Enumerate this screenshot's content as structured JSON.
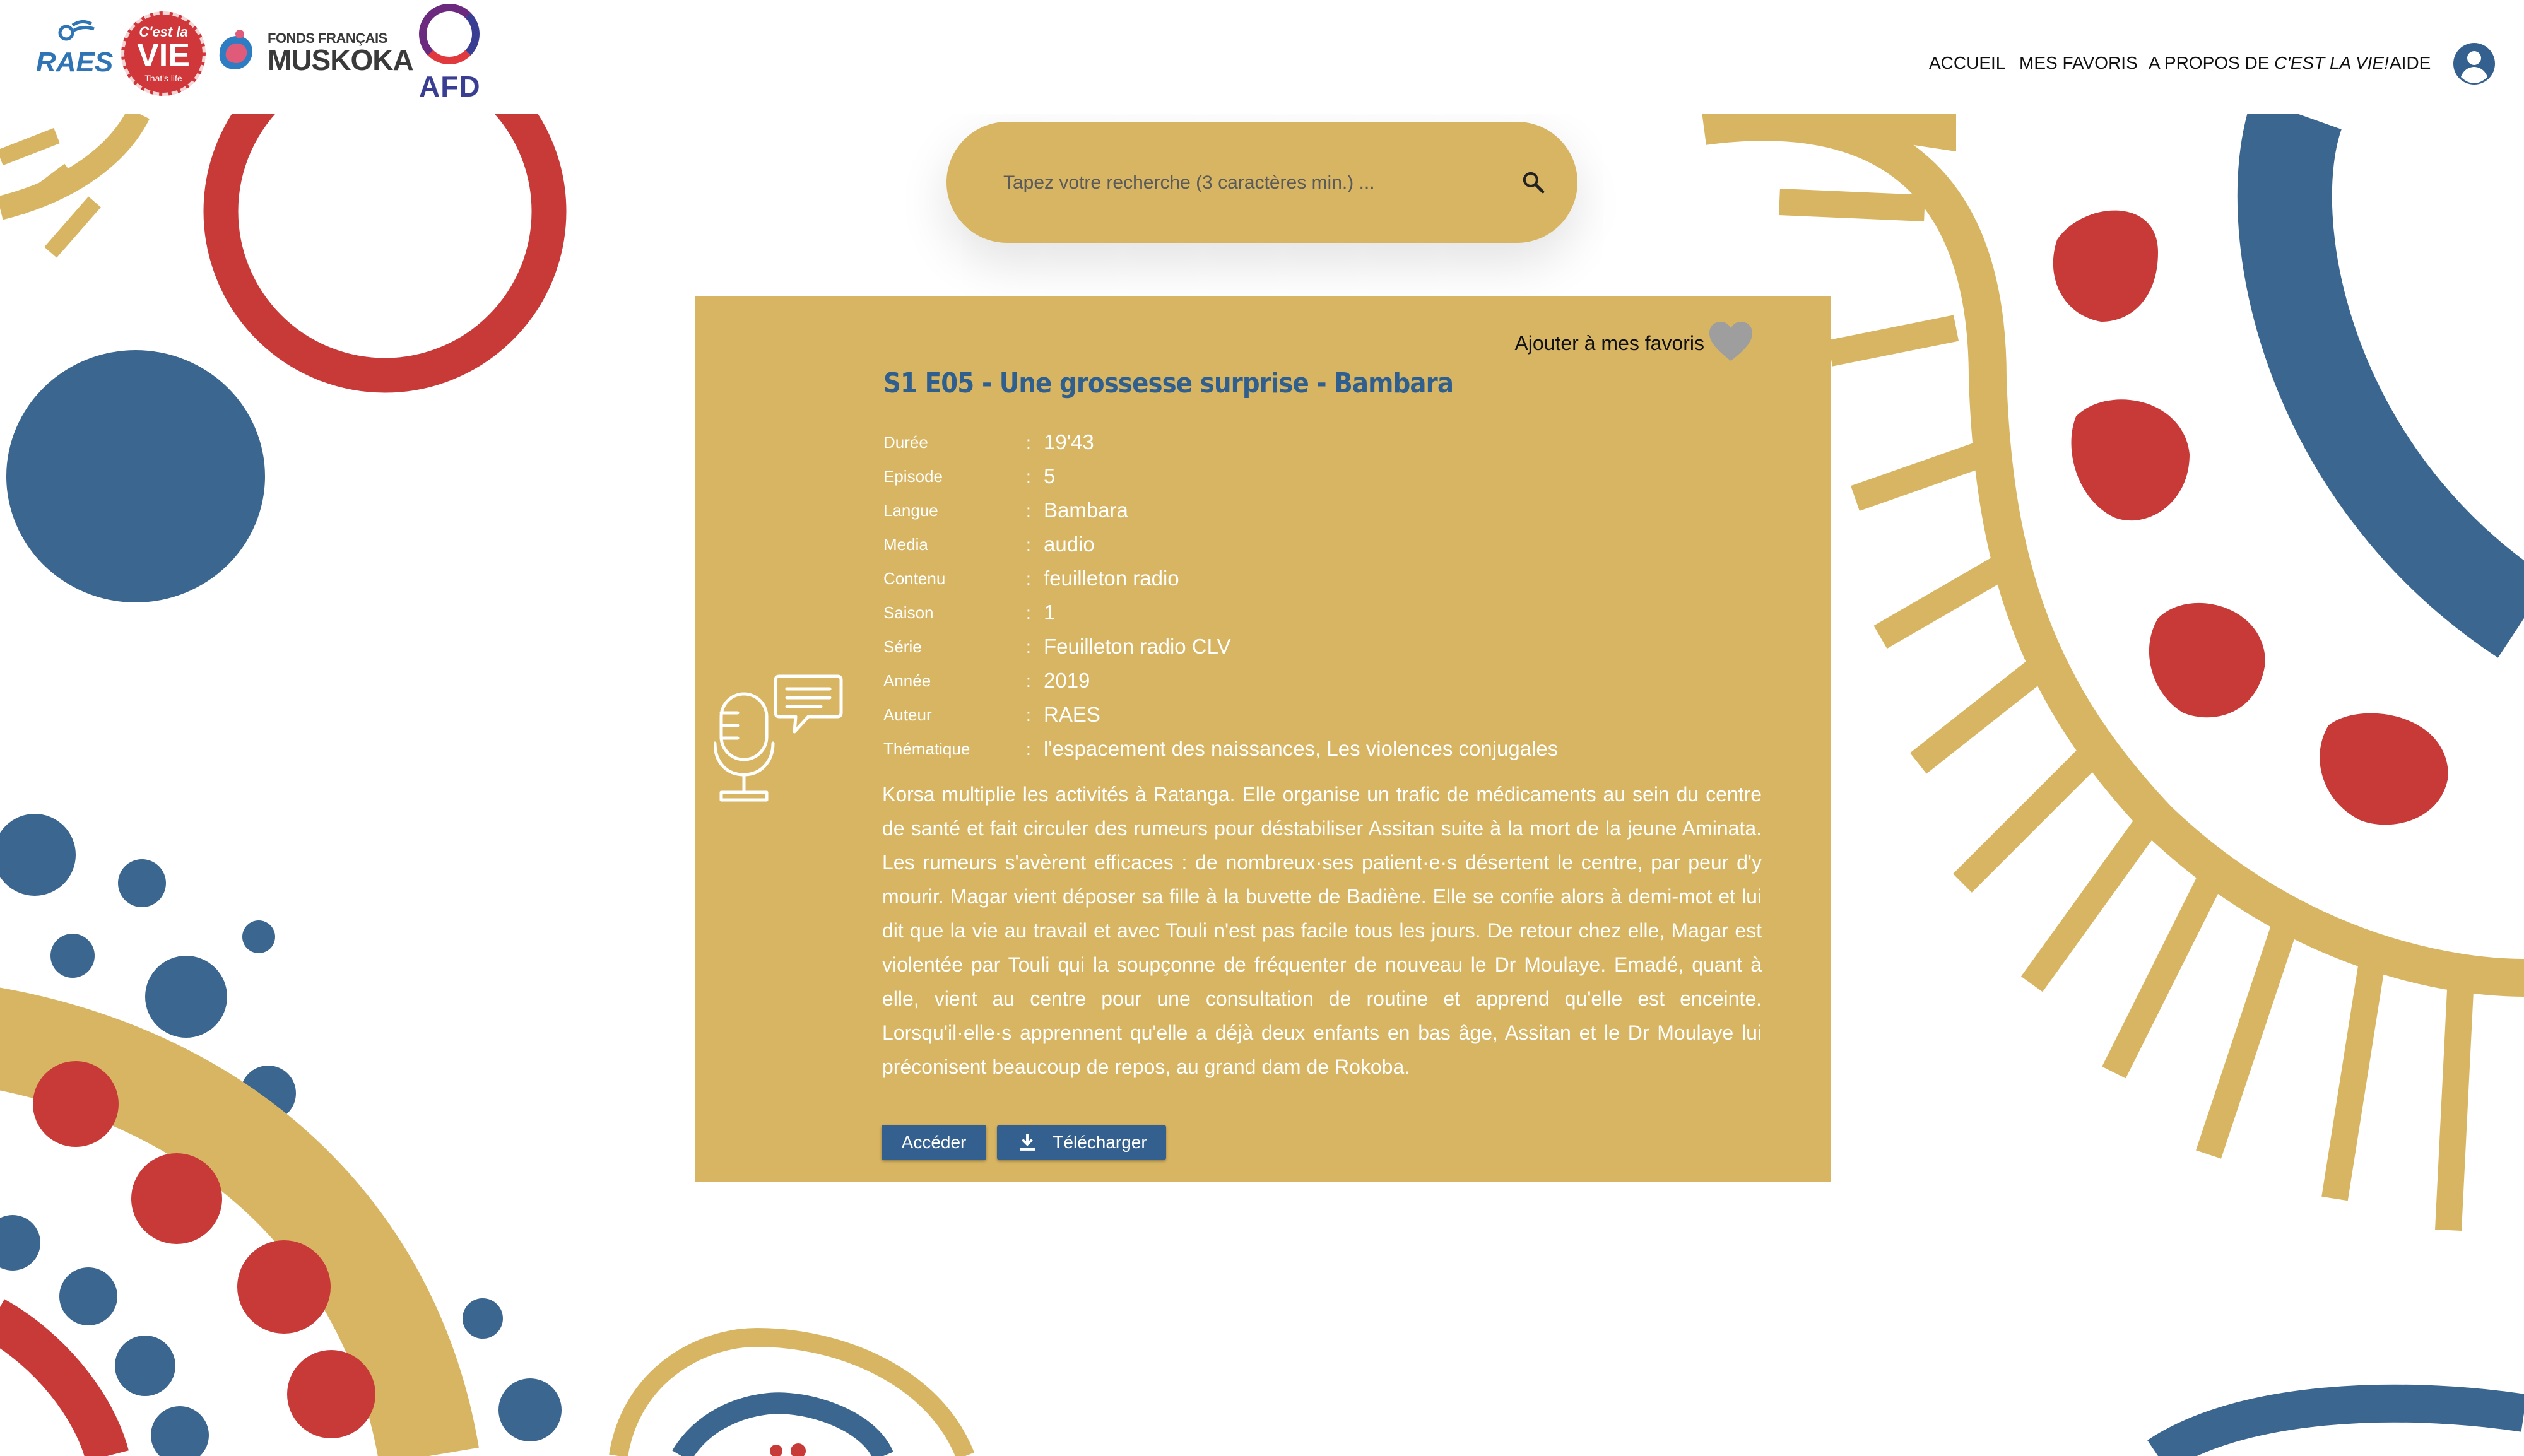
{
  "header": {
    "logos": {
      "raes": "RAES",
      "clv_top": "C'est la",
      "clv_main": "VIE",
      "clv_sub": "That's life",
      "muskoka_line1": "FONDS FRANÇAIS",
      "muskoka_line2": "MUSKOKA",
      "afd": "AFD"
    },
    "nav": {
      "home": "ACCUEIL",
      "favorites": "MES FAVORIS",
      "about_prefix": "A PROPOS DE ",
      "about_em": "C'EST LA VIE!",
      "help": "AIDE"
    },
    "user_icon": "user-circle-icon"
  },
  "search": {
    "placeholder": "Tapez votre recherche (3 caractères min.) ...",
    "value": "",
    "icon": "search-icon"
  },
  "card": {
    "favorite_label": "Ajouter à mes favoris",
    "favorite_icon": "heart-icon",
    "title": "S1 E05 - Une grossesse surprise - Bambara",
    "media_icon": "microphone-speech-icon",
    "separator": ":",
    "meta": [
      {
        "key": "Durée",
        "value": "19'43"
      },
      {
        "key": "Episode",
        "value": "5"
      },
      {
        "key": "Langue",
        "value": "Bambara"
      },
      {
        "key": "Media",
        "value": "audio"
      },
      {
        "key": "Contenu",
        "value": "feuilleton radio"
      },
      {
        "key": "Saison",
        "value": "1"
      },
      {
        "key": "Série",
        "value": "Feuilleton radio CLV"
      },
      {
        "key": "Année",
        "value": "2019"
      },
      {
        "key": "Auteur",
        "value": "RAES"
      },
      {
        "key": "Thématique",
        "value": "l'espacement des naissances, Les violences conjugales"
      }
    ],
    "description": "Korsa multiplie les activités à Ratanga. Elle organise un trafic de médicaments au sein du centre de santé et  fait circuler des rumeurs pour déstabiliser Assitan suite à la mort de la jeune Aminata. Les rumeurs s'avèrent  efficaces : de nombreux·ses patient·e·s désertent le centre, par peur d'y mourir.  Magar vient déposer sa fille à la buvette de Badiène. Elle se confie alors à demi-mot et lui dit que la vie au  travail et avec Touli n'est pas facile tous les jours. De retour chez elle, Magar est violentée par Touli qui la  soupçonne de fréquenter de nouveau le Dr Moulaye.  Emadé, quant à elle, vient au centre pour une consultation de routine et apprend qu'elle est enceinte.  Lorsqu'il·elle·s apprennent qu'elle a déjà deux enfants en bas âge, Assitan et le Dr Moulaye lui préconisent  beaucoup de repos, au grand dam de Rokoba.",
    "buttons": {
      "access": "Accéder",
      "download": "Télécharger",
      "download_icon": "download-icon"
    }
  },
  "colors": {
    "gold": "#d8b562",
    "blue": "#33608f",
    "red": "#c83a37",
    "title_blue": "#2f5f8e"
  }
}
